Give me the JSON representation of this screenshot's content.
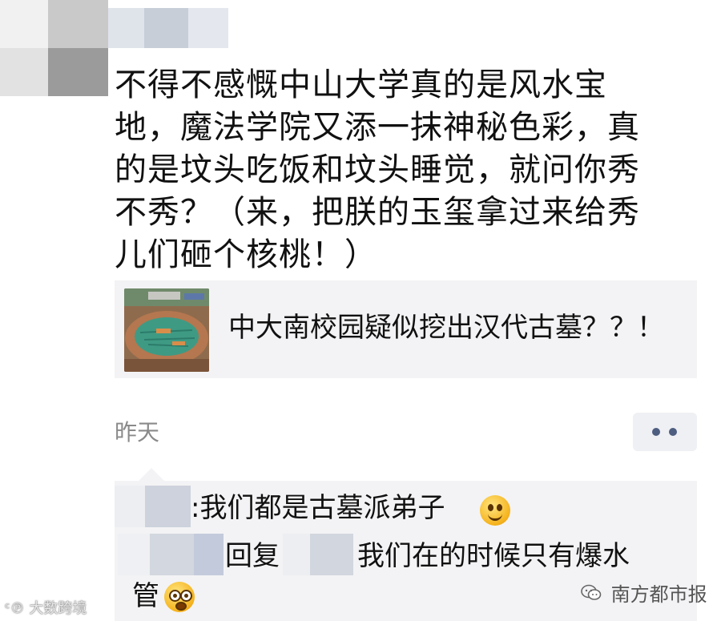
{
  "post": {
    "text": "不得不感慨中山大学真的是风水宝\n地，魔法学院又添一抹神秘色彩，真\n的是坟头吃饭和坟头睡觉，就问你秀\n不秀？（来，把朕的玉玺拿过来给秀\n儿们砸个核桃！）"
  },
  "link_card": {
    "title": "中大南校园疑似挖出汉代古墓？？！"
  },
  "meta": {
    "timestamp": "昨天"
  },
  "comments": [
    {
      "text": ":我们都是古墓派弟子",
      "emoji": "smile-emoji"
    },
    {
      "reply_label": "回复",
      "text": "我们在的时候只有爆水",
      "text_wrap": "管",
      "emoji": "shocked-emoji"
    }
  ],
  "watermarks": {
    "left": "大数跨境",
    "right": "南方都市报"
  },
  "colors": {
    "timestamp": "#8a8a8a",
    "more_dots": "#4e5e80",
    "card_bg": "#f3f3f5"
  }
}
